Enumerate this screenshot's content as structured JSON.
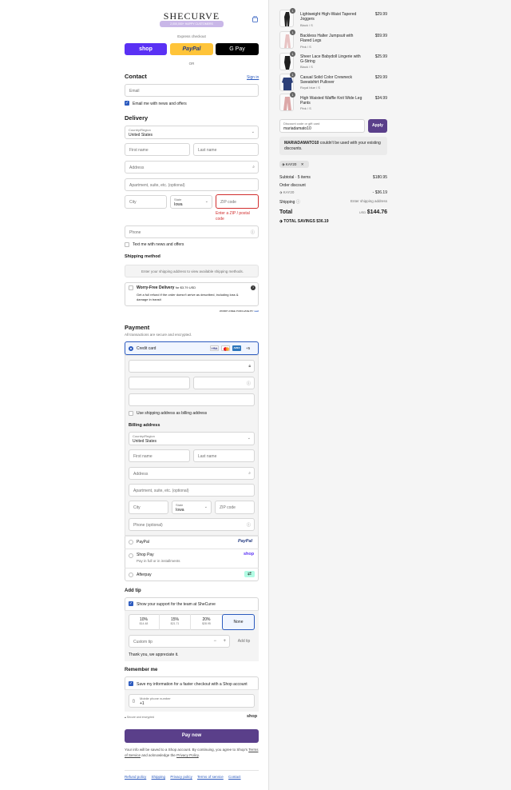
{
  "header": {
    "brand": "SHECURVE",
    "tagline": "2,000,000+ HAPPY CUSTOMERS",
    "cart_icon": "bag-icon"
  },
  "express": {
    "label": "Express checkout",
    "shop": "shop",
    "paypal": "PayPal",
    "gpay": "G Pay",
    "or": "OR"
  },
  "contact": {
    "title": "Contact",
    "signin": "Sign in",
    "email_placeholder": "Email",
    "newsletter": "Email me with news and offers"
  },
  "delivery": {
    "title": "Delivery",
    "country_label": "Country/Region",
    "country": "United States",
    "first_name": "First name",
    "last_name": "Last name",
    "address": "Address",
    "apartment": "Apartment, suite, etc. (optional)",
    "city": "City",
    "state_label": "State",
    "state": "Iowa",
    "zip": "ZIP code",
    "zip_error": "Enter a ZIP / postal code",
    "phone": "Phone",
    "text_me": "Text me with news and offers"
  },
  "shipping": {
    "title": "Shipping method",
    "placeholder": "Enter your shipping address to view available shipping methods."
  },
  "worry_free": {
    "title": "Worry-Free Delivery",
    "price": "for $3.79 USD",
    "desc": "Get a full refund if the order doesn't arrive as described, including loss & damage in transit",
    "powered": "WORRY-FREE PURCHASE BY",
    "powered_brand": "seel"
  },
  "payment": {
    "title": "Payment",
    "subtitle": "All transactions are secure and encrypted.",
    "credit_card": "Credit card",
    "card_more": "+5",
    "use_shipping": "Use shipping address as billing address",
    "billing_title": "Billing address",
    "country_label": "Country/Region",
    "country": "United States",
    "first_name": "First name",
    "last_name": "Last name",
    "address": "Address",
    "apartment": "Apartment, suite, etc. (optional)",
    "city": "City",
    "state_label": "State",
    "state": "Iowa",
    "zip": "ZIP code",
    "phone": "Phone (optional)",
    "paypal": "PayPal",
    "paypal_logo": "PayPal",
    "shoppay": "Shop Pay",
    "shoppay_sub": "Pay in full or in installments",
    "shoppay_logo": "shop",
    "afterpay": "Afterpay"
  },
  "tip": {
    "title": "Add tip",
    "support": "Show your support for the team at SheCurve",
    "options": [
      {
        "pct": "10%",
        "amt": "$14.48"
      },
      {
        "pct": "15%",
        "amt": "$21.71"
      },
      {
        "pct": "20%",
        "amt": "$28.95"
      },
      {
        "pct": "None",
        "amt": ""
      }
    ],
    "custom": "Custom tip",
    "add": "Add tip",
    "thanks": "Thank you, we appreciate it."
  },
  "remember": {
    "title": "Remember me",
    "save": "Save my information for a faster checkout with a Shop account",
    "mobile_label": "Mobile phone number",
    "mobile_val": "+1",
    "secure": "Secure and encrypted",
    "shop": "shop"
  },
  "paynow": "Pay now",
  "legal": {
    "pre": "Your info will be saved to a Shop account. By continuing, you agree to Shop's",
    "terms": "Terms of Service",
    "mid": "and acknowledge the",
    "privacy": "Privacy Policy",
    "end": "."
  },
  "footer": [
    "Refund policy",
    "Shipping",
    "Privacy policy",
    "Terms of service",
    "Contact"
  ],
  "cart": {
    "items": [
      {
        "name": "Lightweight High-Waist Tapered Joggers",
        "variant": "Black / S",
        "price": "$29.99",
        "qty": "1"
      },
      {
        "name": "Backless Halter Jumpsuit with Flared Legs",
        "variant": "Pink / S",
        "price": "$59.99",
        "qty": "1"
      },
      {
        "name": "Sheer Lace Babydoll Lingerie with G-String",
        "variant": "Black / S",
        "price": "$25.99",
        "qty": "1"
      },
      {
        "name": "Casual Solid Color Crewneck Sweatshirt Pullover",
        "variant": "Royal blue / S",
        "price": "$29.99",
        "qty": "1"
      },
      {
        "name": "High Waisted Waffle Knit Wide Leg Pants",
        "variant": "Pink / S",
        "price": "$34.99",
        "qty": "1"
      }
    ],
    "discount_label": "Discount code or gift card",
    "discount_value": "mariadamato10",
    "apply": "Apply",
    "error_code": "MARIADAMATO10",
    "error_text": "couldn't be used with your existing discounts.",
    "tag": "KAY20",
    "subtotal_label": "Subtotal · 5 items",
    "subtotal": "$180.95",
    "order_discount": "Order discount",
    "discount_code": "KAY20",
    "discount_amount": "- $36.19",
    "shipping_label": "Shipping",
    "shipping_value": "Enter shipping address",
    "total_label": "Total",
    "currency": "USD",
    "total": "$144.76",
    "savings_label": "TOTAL SAVINGS",
    "savings": "$36.19"
  },
  "colors": {
    "accent": "#5a3f8a",
    "link": "#2c5bbf",
    "error": "#d12e2e",
    "paypal": "#ffc439"
  }
}
